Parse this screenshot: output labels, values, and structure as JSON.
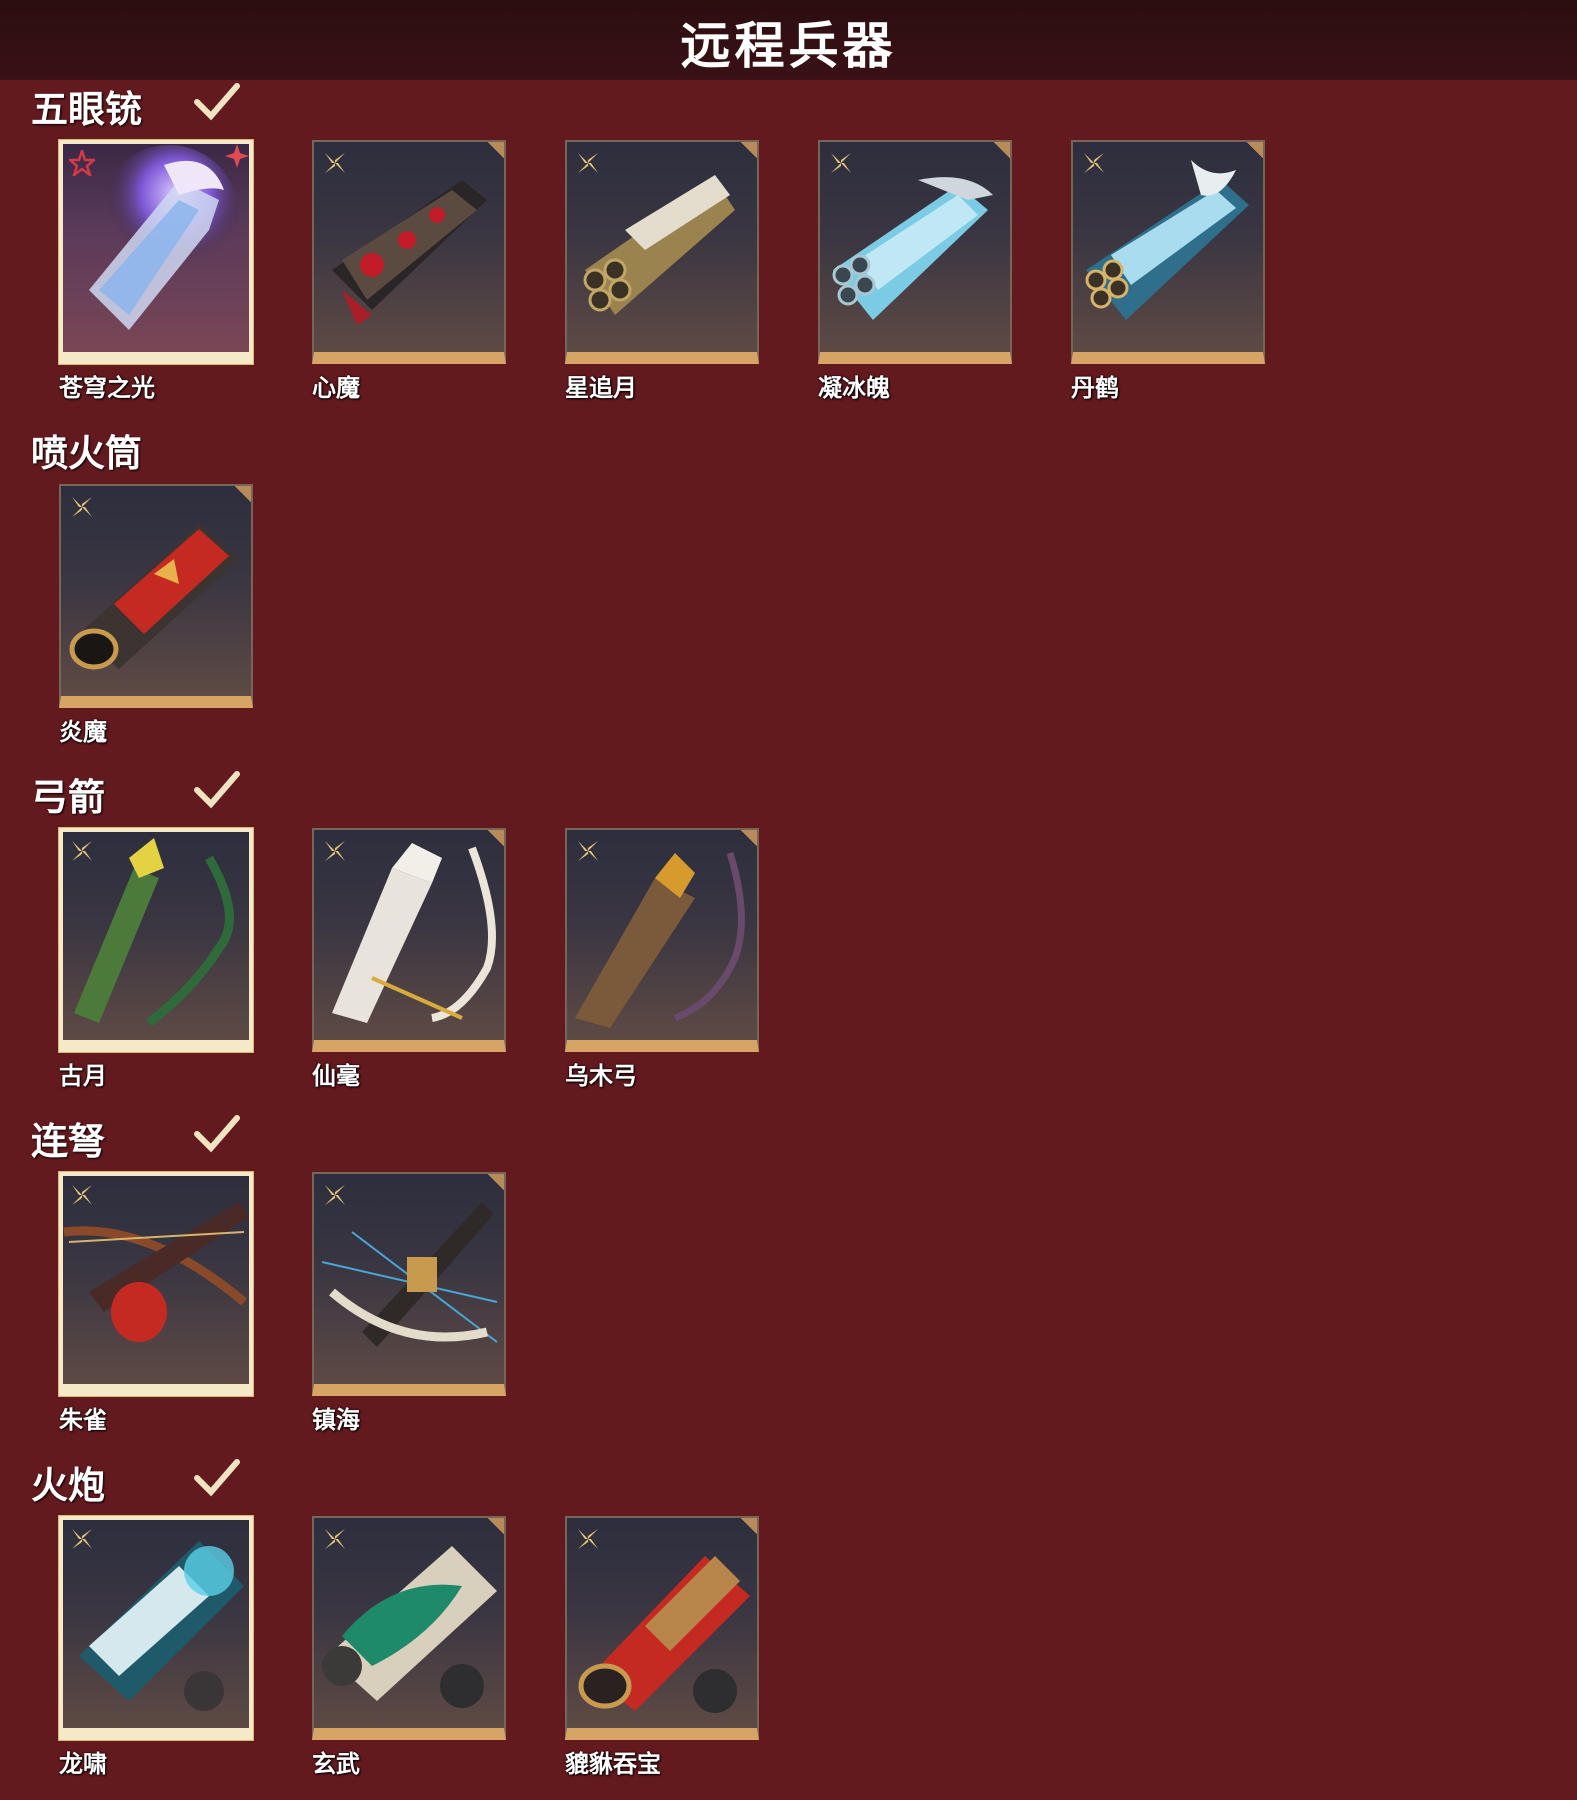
{
  "header": {
    "title": "远程兵器"
  },
  "sections": [
    {
      "title": "五眼铳",
      "items": [
        {
          "name": "苍穹之光",
          "rank_icon": "red-star-icon",
          "selected": true,
          "legendary": true
        },
        {
          "name": "心魔",
          "rank_icon": "gold-shuriken-icon",
          "selected": false
        },
        {
          "name": "星追月",
          "rank_icon": "gold-shuriken-icon",
          "selected": false
        },
        {
          "name": "凝冰魄",
          "rank_icon": "gold-shuriken-icon",
          "selected": false
        },
        {
          "name": "丹鹤",
          "rank_icon": "gold-shuriken-icon",
          "selected": false
        }
      ]
    },
    {
      "title": "喷火筒",
      "items": [
        {
          "name": "炎魔",
          "rank_icon": "gold-shuriken-icon",
          "selected": false
        }
      ]
    },
    {
      "title": "弓箭",
      "items": [
        {
          "name": "古月",
          "rank_icon": "gold-shuriken-icon",
          "selected": true
        },
        {
          "name": "仙毫",
          "rank_icon": "gold-shuriken-icon",
          "selected": false
        },
        {
          "name": "乌木弓",
          "rank_icon": "gold-shuriken-icon",
          "selected": false
        }
      ]
    },
    {
      "title": "连弩",
      "items": [
        {
          "name": "朱雀",
          "rank_icon": "gold-shuriken-icon",
          "selected": true
        },
        {
          "name": "镇海",
          "rank_icon": "gold-shuriken-icon",
          "selected": false
        }
      ]
    },
    {
      "title": "火炮",
      "items": [
        {
          "name": "龙啸",
          "rank_icon": "gold-shuriken-icon",
          "selected": true
        },
        {
          "name": "玄武",
          "rank_icon": "gold-shuriken-icon",
          "selected": false
        },
        {
          "name": "貔貅吞宝",
          "rank_icon": "gold-shuriken-icon",
          "selected": false
        }
      ]
    }
  ],
  "colors": {
    "background": "#631a1f",
    "header": "#2b0e10",
    "card_border": "#d6a465",
    "selected_border": "#f6e9c8"
  }
}
